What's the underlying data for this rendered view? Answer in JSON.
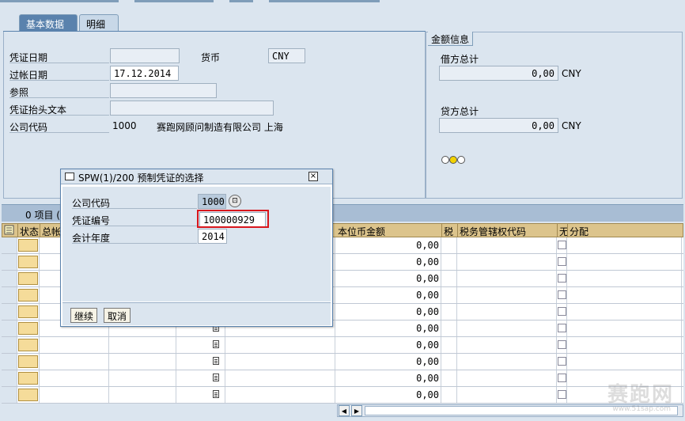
{
  "tabs": [
    {
      "label": "基本数据",
      "active": true
    },
    {
      "label": "明细",
      "active": false
    }
  ],
  "header": {
    "doc_date_label": "凭证日期",
    "doc_date_value": "",
    "currency_label": "货币",
    "currency_value": "CNY",
    "post_date_label": "过帐日期",
    "post_date_value": "17.12.2014",
    "reference_label": "参照",
    "reference_value": "",
    "header_text_label": "凭证抬头文本",
    "header_text_value": "",
    "company_code_label": "公司代码",
    "company_code_value": "1000",
    "company_name": "赛跑网顾问制造有限公司 上海"
  },
  "amount_info": {
    "title": "金额信息",
    "debit_label": "借方总计",
    "debit_value": "0,00",
    "debit_currency": "CNY",
    "credit_label": "贷方总计",
    "credit_value": "0,00",
    "credit_currency": "CNY"
  },
  "table": {
    "item_count": "0 项目 (",
    "columns": [
      "状态",
      "总帐",
      "本位币金额",
      "税",
      "税务管辖权代码",
      "无",
      "分配"
    ],
    "row_amount": "0,00",
    "row_count": 10
  },
  "dialog": {
    "title": "SPW(1)/200 预制凭证的选择",
    "company_code_label": "公司代码",
    "company_code_value": "1000",
    "doc_number_label": "凭证编号",
    "doc_number_value": "100000929",
    "fiscal_year_label": "会计年度",
    "fiscal_year_value": "2014",
    "continue_label": "继续",
    "cancel_label": "取消"
  },
  "watermark": {
    "text": "赛跑网",
    "sub": "www.51sap.com"
  },
  "colors": {
    "accent": "#5a82ad",
    "highlight": "#d9161c",
    "header_bg": "#dcc48c"
  }
}
